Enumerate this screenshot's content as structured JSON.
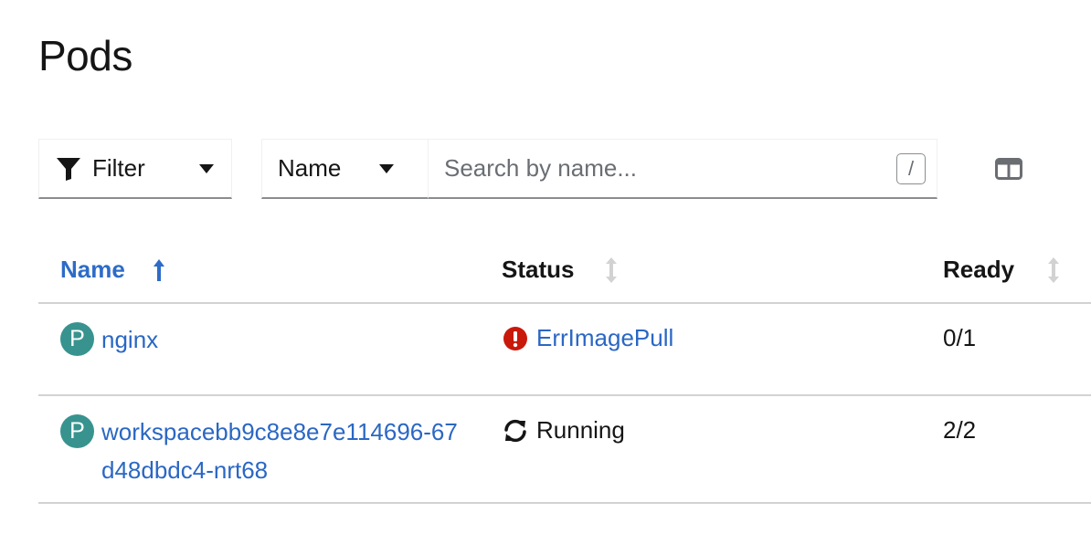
{
  "page": {
    "title": "Pods"
  },
  "toolbar": {
    "filter_label": "Filter",
    "attribute_select": "Name",
    "search_placeholder": "Search by name...",
    "search_shortcut": "/"
  },
  "table": {
    "columns": [
      {
        "label": "Name",
        "sort": "ascending"
      },
      {
        "label": "Status",
        "sort": "none"
      },
      {
        "label": "Ready",
        "sort": "none"
      }
    ],
    "rows": [
      {
        "badge": "P",
        "name": "nginx",
        "status": "ErrImagePull",
        "status_icon": "exclamation-circle-icon",
        "ready": "0/1"
      },
      {
        "badge": "P",
        "name": "workspacebb9c8e8e7e114696-67d48dbdc4-nrt68",
        "status": "Running",
        "status_icon": "sync-icon",
        "ready": "2/2"
      }
    ]
  },
  "colors": {
    "link": "#2a67c4",
    "pod_badge": "#38938f",
    "error": "#c9190b",
    "border": "#d2d2d2"
  }
}
